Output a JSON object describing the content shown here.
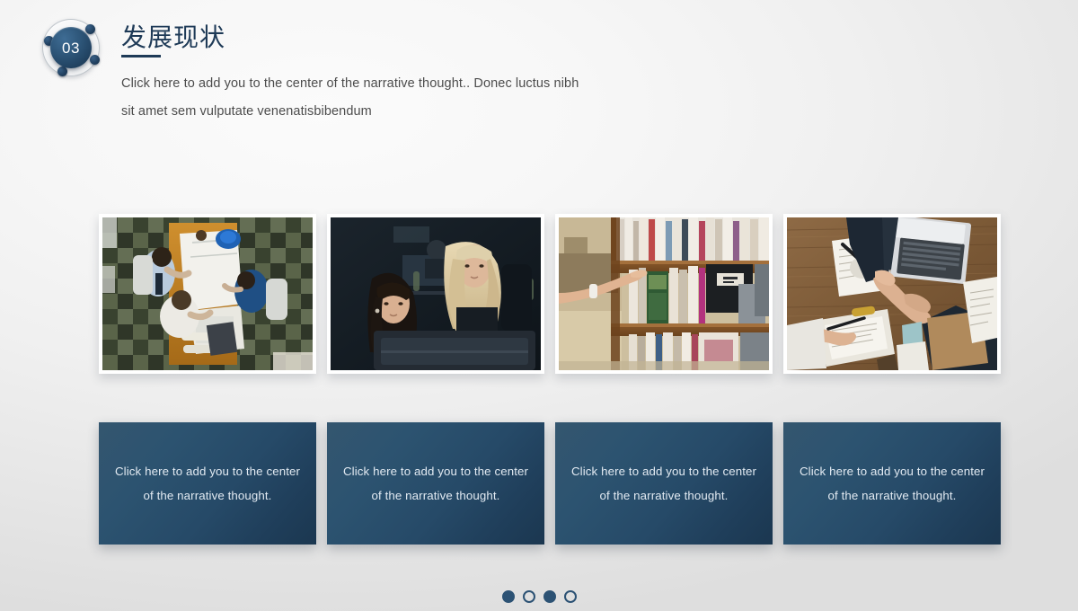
{
  "slide": {
    "number": "03",
    "title": "发展现状",
    "subtitle": "Click here to add  you to the  center of the  narrative thought.. Donec luctus nibh sit amet sem vulputate venenatisbibendum",
    "accent_color": "#1e3a57",
    "badge_color": "#2d5578",
    "box_color": "#2c5370",
    "background_color": "#f4f4f4"
  },
  "photos": [
    {
      "alt": "Overhead view of three colleagues reviewing blueprints at a meeting table with a blue hard hat",
      "icon": "meeting-blueprints-photo"
    },
    {
      "alt": "Two women looking at a computer monitor in a dimly lit office",
      "icon": "two-women-at-monitor-photo"
    },
    {
      "alt": "A hand reaching for a book on a wooden library shelf",
      "icon": "library-shelf-hand-photo"
    },
    {
      "alt": "Overhead handshake over a wooden desk with a laptop and paperwork",
      "icon": "handshake-desk-photo"
    }
  ],
  "captions": [
    {
      "text": "Click here to add  you to the center of the  narrative thought."
    },
    {
      "text": "Click here to add  you to the center of the  narrative thought."
    },
    {
      "text": "Click here to add  you to the center of the  narrative thought."
    },
    {
      "text": "Click here to add  you to the center of the  narrative thought."
    }
  ],
  "pager": {
    "total": 4,
    "states": [
      "active",
      "inactive",
      "active",
      "inactive"
    ]
  }
}
